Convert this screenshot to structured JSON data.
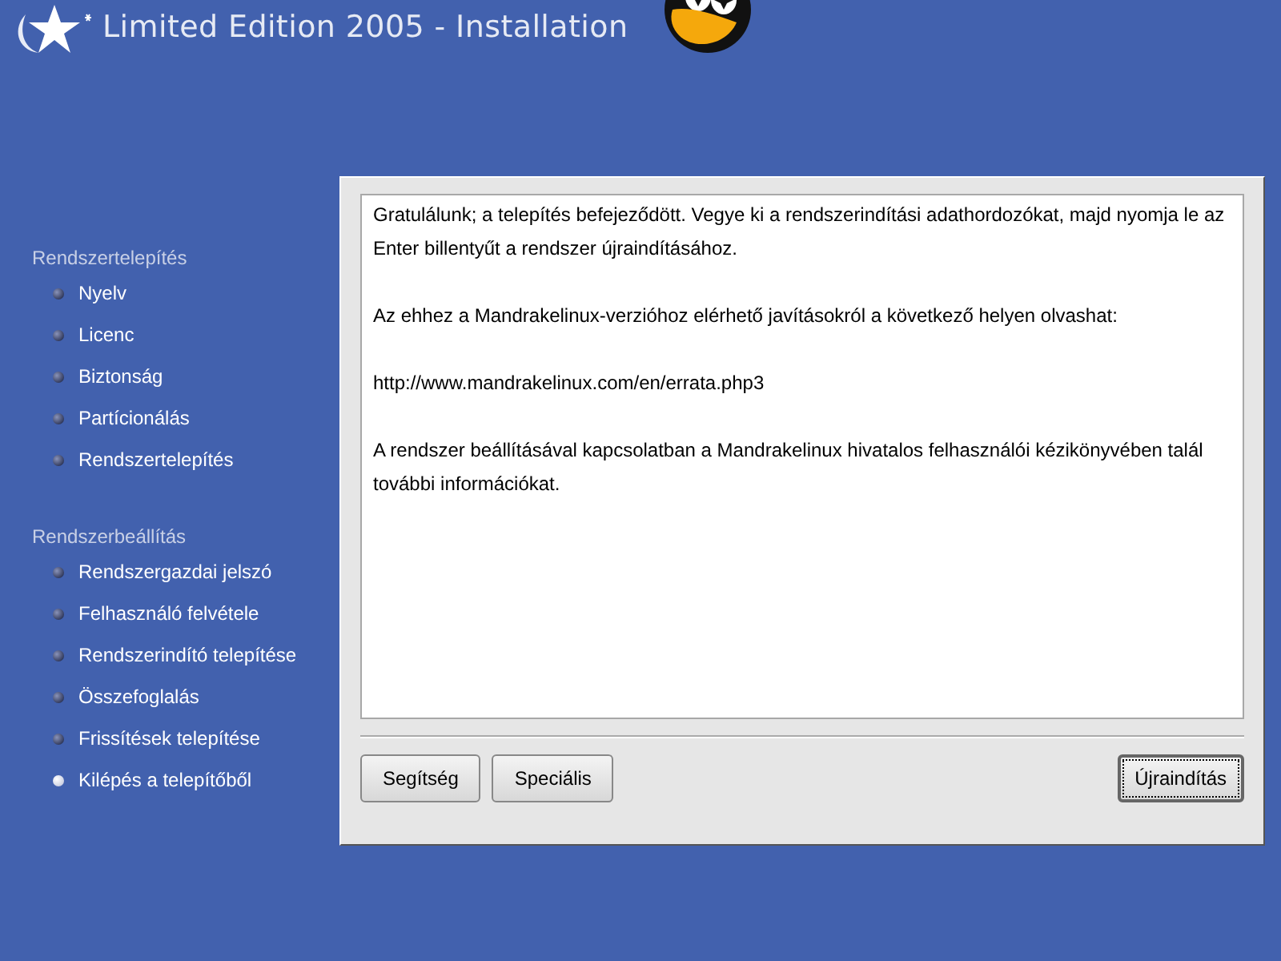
{
  "header": {
    "title": "Limited Edition 2005 - Installation"
  },
  "sidebar": {
    "sections": [
      {
        "title": "Rendszertelepítés",
        "items": [
          {
            "label": "Nyelv",
            "selected": false
          },
          {
            "label": "Licenc",
            "selected": false
          },
          {
            "label": "Biztonság",
            "selected": false
          },
          {
            "label": "Partícionálás",
            "selected": false
          },
          {
            "label": "Rendszertelepítés",
            "selected": false
          }
        ]
      },
      {
        "title": "Rendszerbeállítás",
        "items": [
          {
            "label": "Rendszergazdai jelszó",
            "selected": false
          },
          {
            "label": "Felhasználó felvétele",
            "selected": false
          },
          {
            "label": "Rendszerindító telepítése",
            "selected": false
          },
          {
            "label": "Összefoglalás",
            "selected": false
          },
          {
            "label": "Frissítések telepítése",
            "selected": false
          },
          {
            "label": "Kilépés a telepítőből",
            "selected": true
          }
        ]
      }
    ]
  },
  "message": {
    "paragraphs": [
      "Gratulálunk; a telepítés befejeződött. Vegye ki a rendszerindítási adathordozókat, majd nyomja le az Enter billentyűt a rendszer újraindításához.",
      "Az ehhez a Mandrakelinux-verzióhoz elérhető javításokról a következő helyen olvashat:",
      "http://www.mandrakelinux.com/en/errata.php3",
      "A rendszer beállításával kapcsolatban a Mandrakelinux hivatalos felhasználói kézikönyvében talál további információkat."
    ]
  },
  "buttons": [
    {
      "label": "Segítség",
      "focused": false
    },
    {
      "label": "Speciális",
      "focused": false
    },
    {
      "label": "Újraindítás",
      "focused": true
    }
  ]
}
